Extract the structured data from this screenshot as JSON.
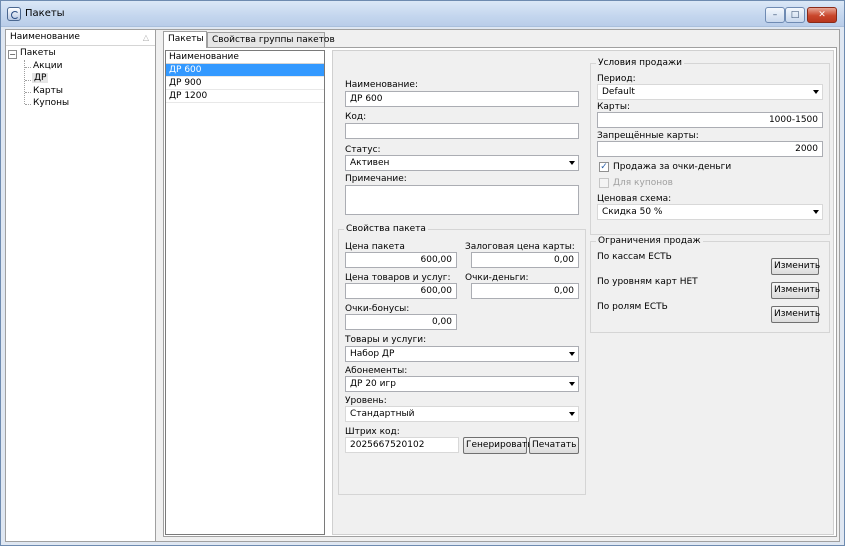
{
  "window": {
    "title": "Пакеты",
    "icon": "app-icon",
    "minimize_glyph": "–",
    "maximize_glyph": "□",
    "close_glyph": "✕"
  },
  "tree": {
    "header": "Наименование",
    "sort_glyph": "△",
    "root": {
      "label": "Пакеты",
      "toggle": "−"
    },
    "children": [
      "Акции",
      "ДР",
      "Карты",
      "Купоны"
    ],
    "selected": "ДР"
  },
  "tabs": [
    {
      "label": "Пакеты",
      "active": true
    },
    {
      "label": "Свойства группы пакетов",
      "active": false
    }
  ],
  "package_list": {
    "header": "Наименование",
    "rows": [
      "ДР 600",
      "ДР 900",
      "ДР 1200"
    ],
    "selected": "ДР 600"
  },
  "form": {
    "name_label": "Наименование:",
    "name_value": "ДР 600",
    "code_label": "Код:",
    "code_value": "",
    "status_label": "Статус:",
    "status_value": "Активен",
    "note_label": "Примечание:",
    "note_value": ""
  },
  "properties": {
    "title": "Свойства пакета",
    "price_label": "Цена пакета",
    "price_value": "600,00",
    "deposit_label": "Залоговая цена карты:",
    "deposit_value": "0,00",
    "goods_price_label": "Цена товаров и услуг:",
    "goods_price_value": "600,00",
    "points_label": "Очки-деньги:",
    "points_value": "0,00",
    "bonus_label": "Очки-бонусы:",
    "bonus_value": "0,00",
    "goods_label": "Товары и услуги:",
    "goods_value": "Набор ДР",
    "subscriptions_label": "Абонементы:",
    "subscriptions_value": "ДР 20 игр",
    "level_label": "Уровень:",
    "level_value": "Стандартный",
    "barcode_label": "Штрих код:",
    "barcode_value": "2025667520102",
    "generate_button": "Генерировать",
    "print_button": "Печатать"
  },
  "sale_conditions": {
    "title": "Условия продажи",
    "period_label": "Период:",
    "period_value": "Default",
    "cards_label": "Карты:",
    "cards_value": "1000-1500",
    "forbidden_cards_label": "Запрещённые карты:",
    "forbidden_cards_value": "2000",
    "sell_for_points_label": "Продажа за очки-деньги",
    "sell_for_points_checked": true,
    "for_coupons_label": "Для купонов",
    "for_coupons_checked": false,
    "price_scheme_label": "Ценовая схема:",
    "price_scheme_value": "Скидка 50 %"
  },
  "sale_restrictions": {
    "title": "Ограничения продаж",
    "items": [
      {
        "label": "По кассам ЕСТЬ",
        "button": "Изменить"
      },
      {
        "label": "По уровням карт НЕТ",
        "button": "Изменить"
      },
      {
        "label": "По ролям ЕСТЬ",
        "button": "Изменить"
      }
    ]
  }
}
